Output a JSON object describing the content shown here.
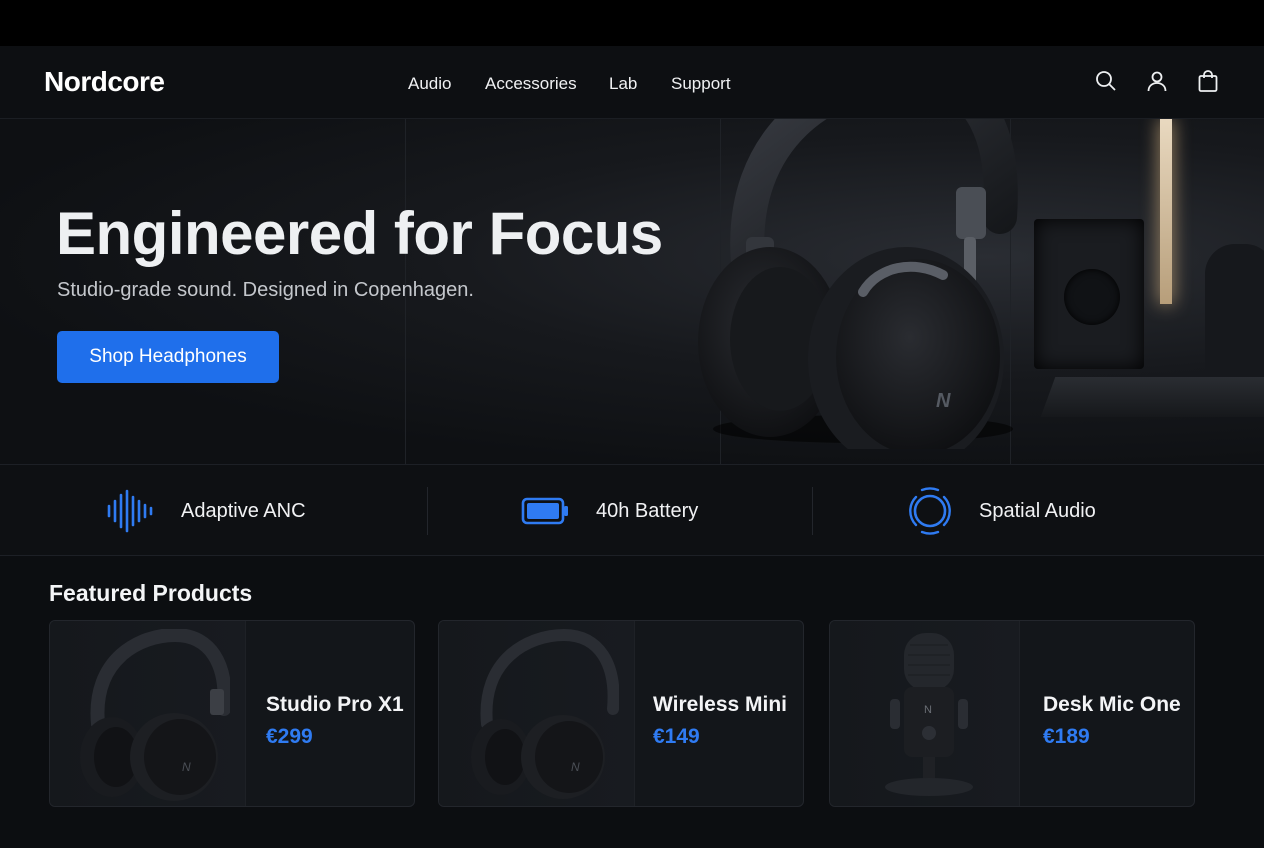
{
  "header": {
    "brand": "Nordcore",
    "nav": [
      "Audio",
      "Accessories",
      "Lab",
      "Support"
    ],
    "icons": [
      "search-icon",
      "account-icon",
      "cart-icon"
    ]
  },
  "hero": {
    "title": "Engineered for Focus",
    "subtitle": "Studio-grade sound. Designed in Copenhagen.",
    "cta_label": "Shop Headphones",
    "image": "headphones-photo",
    "brand_mark": "N"
  },
  "features": [
    {
      "label": "Adaptive ANC",
      "icon": "waveform-icon"
    },
    {
      "label": "40h Battery",
      "icon": "battery-icon"
    },
    {
      "label": "Spatial Audio",
      "icon": "spatial-audio-icon"
    }
  ],
  "featured": {
    "title": "Featured Products",
    "products": [
      {
        "name": "Studio Pro X1",
        "price": "€299",
        "image": "headphones-image"
      },
      {
        "name": "Wireless Mini",
        "price": "€149",
        "image": "headphones-image"
      },
      {
        "name": "Desk Mic One",
        "price": "€189",
        "image": "microphone-image"
      }
    ]
  },
  "colors": {
    "accent": "#1f6feb",
    "price": "#2f7bf2",
    "background": "#0c0e11",
    "surface": "#13161a"
  }
}
